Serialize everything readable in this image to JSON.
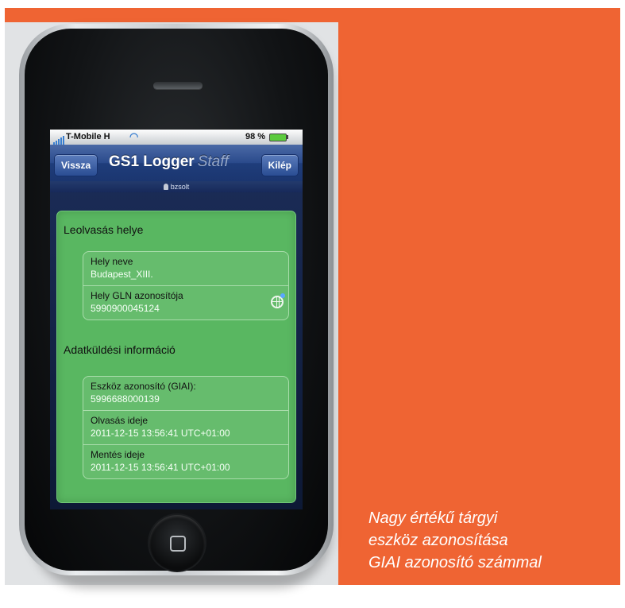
{
  "caption": {
    "line1": "Nagy értékű tárgyi",
    "line2": "eszköz azonosítása",
    "line3": "GIAI azonosító számmal"
  },
  "statusbar": {
    "carrier": "T-Mobile H",
    "battery_percent": "98 %"
  },
  "navbar": {
    "back_label": "Vissza",
    "title": "GS1 Logger",
    "title_suffix": "Staff",
    "exit_label": "Kilép"
  },
  "user": {
    "name": "bzsolt"
  },
  "location_section": {
    "title": "Leolvasás helye",
    "rows": [
      {
        "label": "Hely neve",
        "value": "Budapest_XIII."
      },
      {
        "label": "Hely GLN azonosítója",
        "value": "5990900045124"
      }
    ]
  },
  "transfer_section": {
    "title": "Adatküldési információ",
    "rows": [
      {
        "label": "Eszköz azonosító (GIAI):",
        "value": "5996688000139"
      },
      {
        "label": "Olvasás ideje",
        "value": "2011-12-15 13:56:41 UTC+01:00"
      },
      {
        "label": "Mentés ideje",
        "value": "2011-12-15 13:56:41 UTC+01:00"
      }
    ]
  },
  "icons": {
    "wifi": "wifi-icon",
    "battery": "battery-icon",
    "user": "user-icon",
    "globe": "globe-icon",
    "home": "home-button-icon"
  },
  "colors": {
    "orange_accent": "#ef6433",
    "card_green": "#59b761",
    "navbar_blue": "#2a4a8b"
  }
}
